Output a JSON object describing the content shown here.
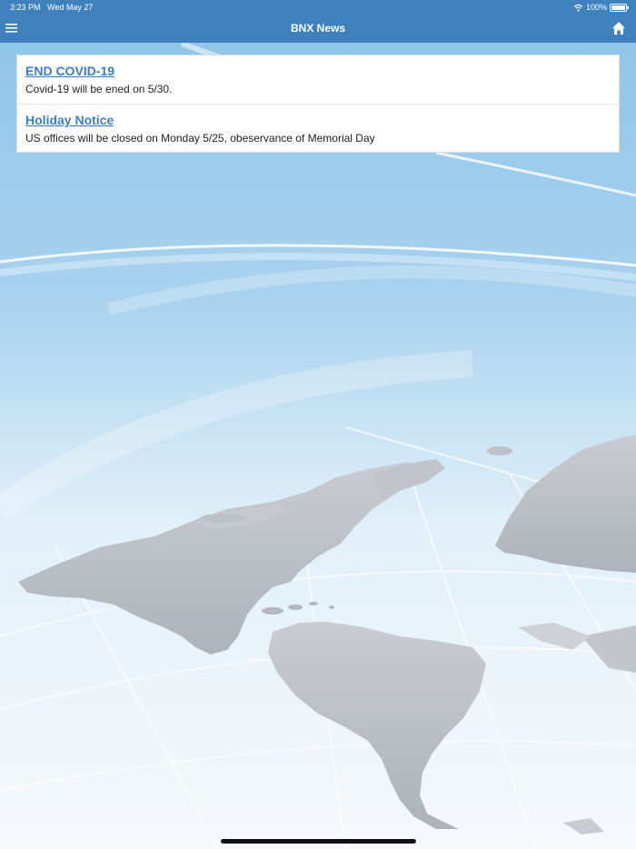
{
  "status_bar": {
    "time": "3:23 PM",
    "date": "Wed May 27",
    "battery": "100%",
    "icons": [
      "wifi-icon",
      "battery-icon"
    ]
  },
  "nav": {
    "title": "BNX News",
    "left_icon": "hamburger-menu-icon",
    "right_icon": "home-icon"
  },
  "news": [
    {
      "title": "END COVID-19",
      "body": "Covid-19 will be ened on 5/30."
    },
    {
      "title": "Holiday Notice",
      "body": "US offices will be closed on Monday 5/25, obeservance of Memorial Day"
    }
  ],
  "colors": {
    "header": "#3f81bd",
    "link": "#3b7ebf",
    "sky": "#8ec3e8",
    "land": "#b9bdc5"
  }
}
